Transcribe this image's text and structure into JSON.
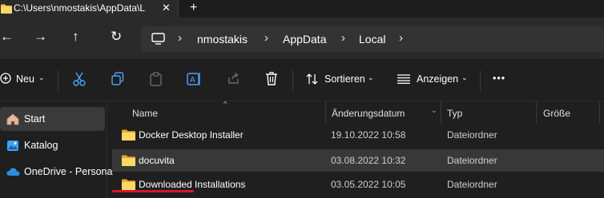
{
  "tab": {
    "title": "C:\\Users\\nmostakis\\AppData\\L",
    "close": "✕",
    "new": "+"
  },
  "nav": {
    "back": "←",
    "forward": "→",
    "up": "↑",
    "refresh": "↻",
    "breadcrumb": [
      {
        "label": "nmostakis"
      },
      {
        "label": "AppData"
      },
      {
        "label": "Local"
      }
    ],
    "separator": "›"
  },
  "toolbar": {
    "new_label": "Neu",
    "sort_label": "Sortieren",
    "view_label": "Anzeigen",
    "more": "•••"
  },
  "sidebar": {
    "items": [
      {
        "label": "Start",
        "icon": "home-icon"
      },
      {
        "label": "Katalog",
        "icon": "gallery-icon"
      },
      {
        "label": "OneDrive - Persona",
        "icon": "cloud-icon"
      }
    ]
  },
  "columns": {
    "name": "Name",
    "date": "Änderungsdatum",
    "type": "Typ",
    "size": "Größe"
  },
  "rows": [
    {
      "name": "Docker Desktop Installer",
      "date": "19.10.2022 10:58",
      "type": "Dateiordner",
      "size": ""
    },
    {
      "name": "docuvita",
      "date": "03.08.2022 10:32",
      "type": "Dateiordner",
      "size": ""
    },
    {
      "name": "Downloaded Installations",
      "date": "03.05.2022 10:05",
      "type": "Dateiordner",
      "size": ""
    }
  ],
  "colors": {
    "accent": "#d11a2a",
    "folder": "#f5c54a",
    "selection": "#383838"
  }
}
